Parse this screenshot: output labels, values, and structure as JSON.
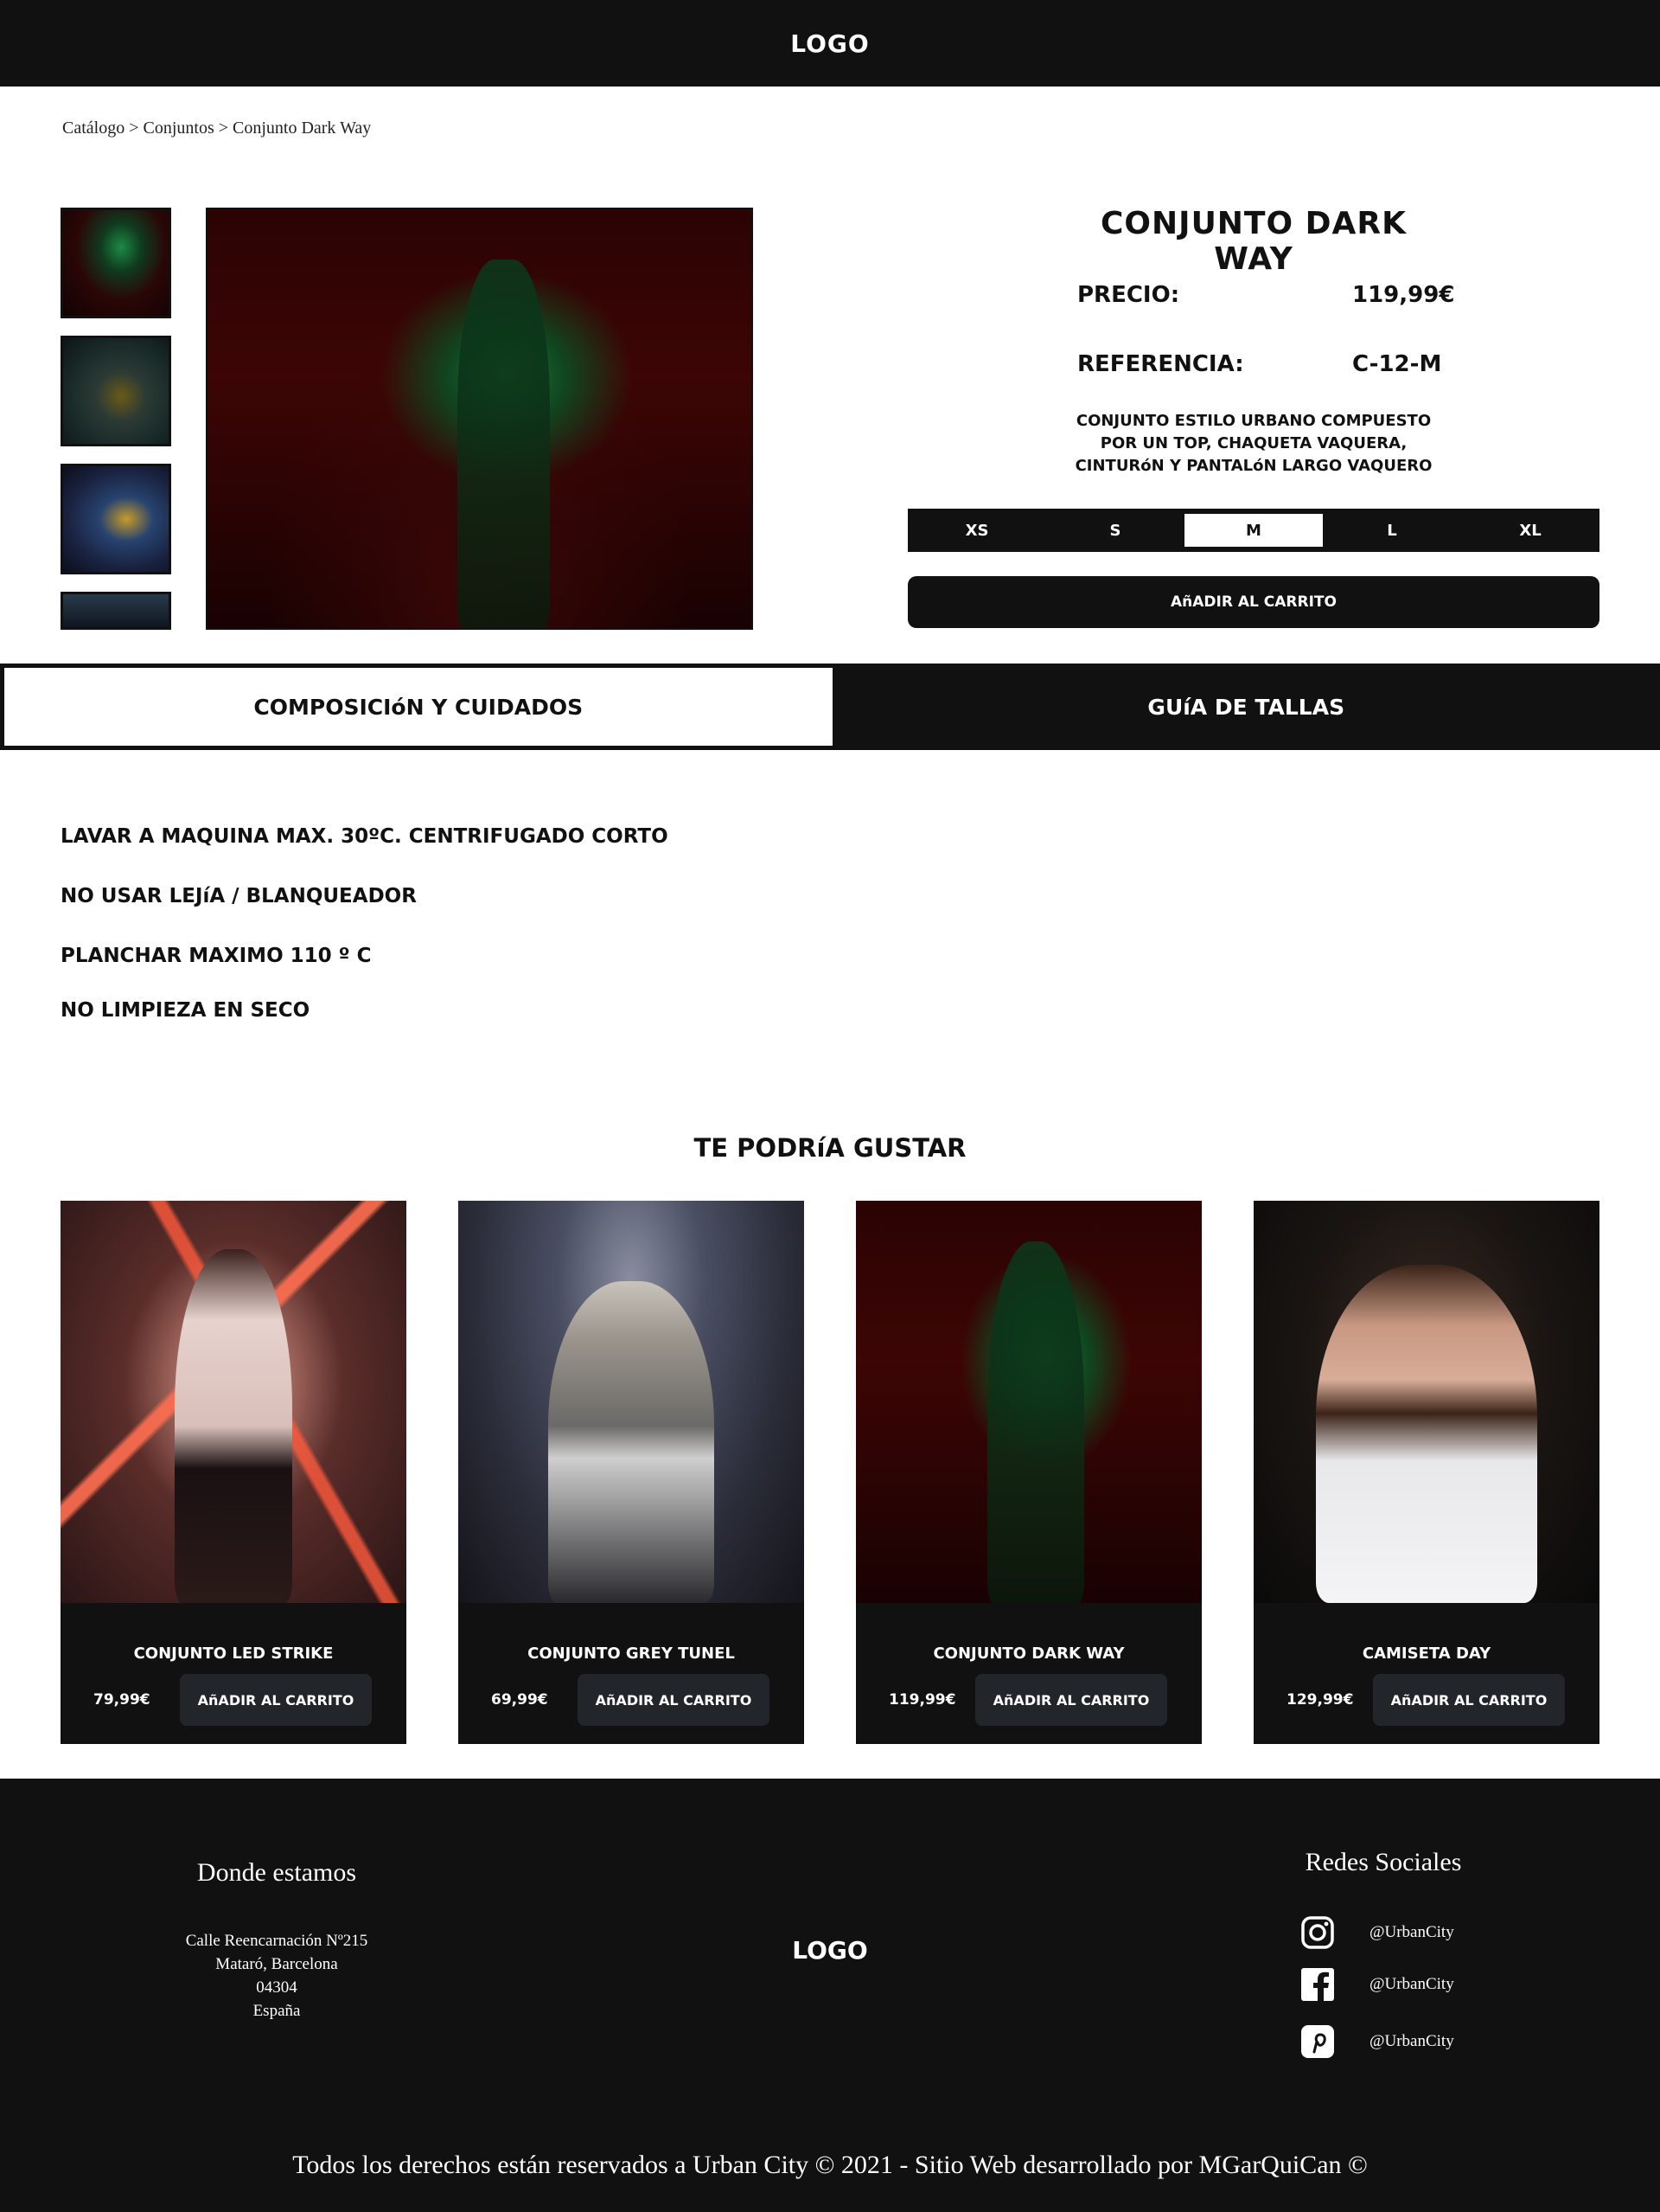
{
  "header": {
    "logo": "LOGO"
  },
  "breadcrumb": "Catálogo > Conjuntos > Conjunto Dark Way",
  "product": {
    "title": "CONJUNTO DARK WAY",
    "price_label": "PRECIO:",
    "price": "119,99€",
    "ref_label": "REFERENCIA:",
    "ref": "C-12-M",
    "description": [
      "CONJUNTO ESTILO URBANO COMPUESTO",
      "POR UN TOP, CHAQUETA VAQUERA,",
      "CINTURóN Y PANTALóN LARGO VAQUERO"
    ],
    "sizes": [
      "XS",
      "S",
      "M",
      "L",
      "XL"
    ],
    "selected_size": "M",
    "add_to_cart": "AñADIR AL CARRITO"
  },
  "tabs": {
    "composition": "COMPOSICIóN Y CUIDADOS",
    "size_guide": "GUíA DE TALLAS"
  },
  "care": [
    "LAVAR A MAQUINA MAX. 30ºC. CENTRIFUGADO CORTO",
    "NO USAR LEJíA / BLANQUEADOR",
    "PLANCHAR MAXIMO 110 º C",
    "NO LIMPIEZA EN SECO"
  ],
  "recommendations": {
    "title": "TE PODRíA GUSTAR",
    "items": [
      {
        "name": "CONJUNTO LED STRIKE",
        "price": "79,99€",
        "button": "AñADIR AL CARRITO"
      },
      {
        "name": "CONJUNTO GREY TUNEL",
        "price": "69,99€",
        "button": "AñADIR AL CARRITO"
      },
      {
        "name": "CONJUNTO DARK WAY",
        "price": "119,99€",
        "button": "AñADIR AL CARRITO"
      },
      {
        "name": "CAMISETA DAY",
        "price": "129,99€",
        "button": "AñADIR AL CARRITO"
      }
    ]
  },
  "footer": {
    "where_title": "Donde estamos",
    "address": [
      "Calle Reencarnación Nº215",
      "Mataró, Barcelona",
      "04304",
      "España"
    ],
    "logo": "LOGO",
    "social_title": "Redes Sociales",
    "social": [
      {
        "icon": "instagram-icon",
        "handle": "@UrbanCity"
      },
      {
        "icon": "facebook-icon",
        "handle": "@UrbanCity"
      },
      {
        "icon": "pinterest-icon",
        "handle": "@UrbanCity"
      }
    ],
    "copyright": "Todos los derechos están reservados a Urban City © 2021  - Sitio Web desarrollado por MGarQuiCan ©"
  },
  "colors": {
    "dark": "#111111",
    "button_dark": "#22252a",
    "white": "#ffffff"
  }
}
